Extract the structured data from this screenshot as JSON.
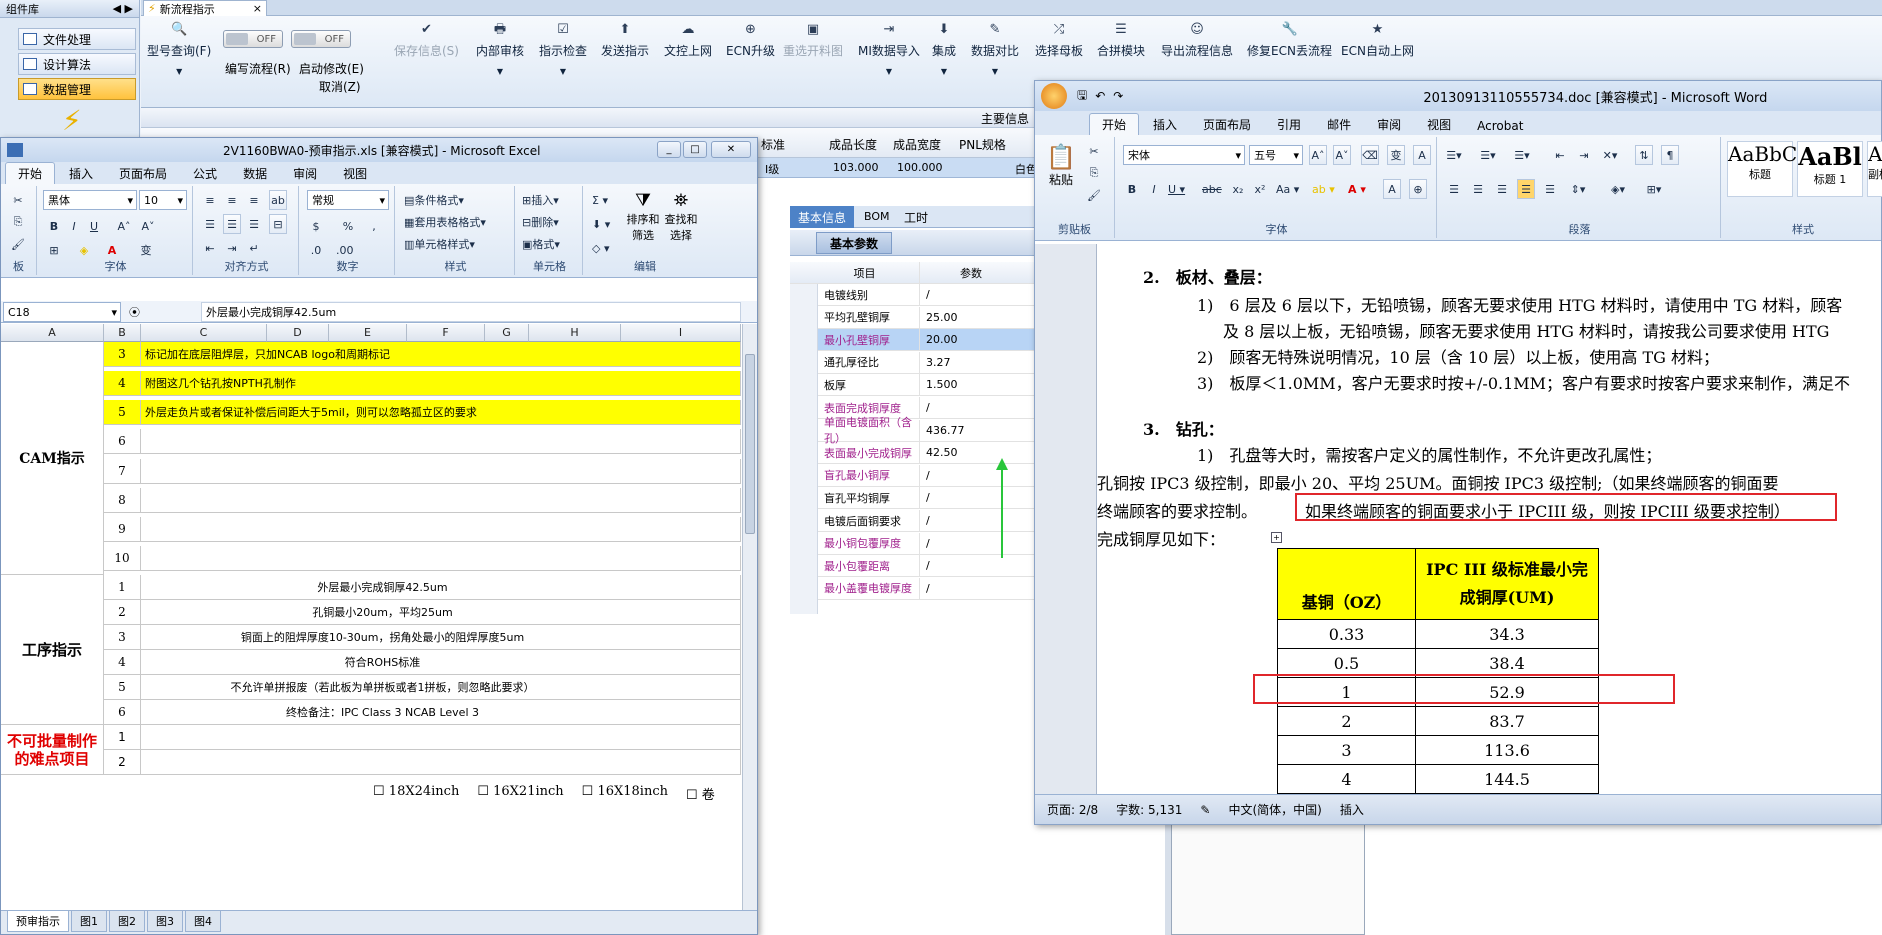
{
  "sidebar": {
    "header": "组件库",
    "items": [
      "文件处理",
      "设计算法",
      "数据管理"
    ]
  },
  "app": {
    "tab": "新流程指示",
    "toolbar": {
      "type_query": "型号查询(F)",
      "write_flow": "编写流程(R)",
      "start_modify": "启动修改(E)",
      "cancel": "取消(Z)",
      "save": "保存信息(S)",
      "audit": "内部审核",
      "check": "指示检查",
      "send": "发送指示",
      "upload": "文控上网",
      "ecn_up": "ECN升级",
      "reselect": "重选开料图",
      "mi_import": "MI数据导入",
      "integrate": "集成",
      "compare": "数据对比",
      "select_parent": "选择母板",
      "merge": "合拼模块",
      "export": "导出流程信息",
      "fix_ecn": "修复ECN丢流程",
      "ecn_auto": "ECN自动上网",
      "off1": "OFF",
      "off2": "OFF"
    },
    "grid_header": {
      "main_info": "主要信息",
      "std": "标准",
      "len": "成品长度",
      "wid": "成品宽度",
      "pnl": "PNL规格",
      "level": "I级",
      "len_v": "103.000",
      "wid_v": "100.000",
      "white": "白色"
    }
  },
  "excel": {
    "title": "2V1160BWA0-预审指示.xls [兼容模式] - Microsoft Excel",
    "tabs": [
      "开始",
      "插入",
      "页面布局",
      "公式",
      "数据",
      "审阅",
      "视图"
    ],
    "font": "黑体",
    "size": "10",
    "numfmt": "常规",
    "groups": {
      "clip": "板",
      "font": "字体",
      "align": "对齐方式",
      "num": "数字",
      "style": "样式",
      "cells": "单元格",
      "edit": "编辑"
    },
    "style_btns": [
      "条件格式",
      "套用表格格式",
      "单元格样式"
    ],
    "cell_btns": [
      "插入",
      "删除",
      "格式"
    ],
    "edit_btns": [
      "排序和筛选",
      "查找和选择"
    ],
    "namebox": "C18",
    "formula": "外层最小完成铜厚42.5um",
    "cols": [
      "A",
      "B",
      "C",
      "D",
      "E",
      "F",
      "G",
      "H",
      "I"
    ],
    "sections": {
      "cam": "CAM指示",
      "proc": "工序指示",
      "hard": "不可批量制作的难点项目"
    },
    "cam_rows": [
      [
        "3",
        "标记加在底层阻焊层，只加NCAB logo和周期标记"
      ],
      [
        "4",
        "附图这几个钻孔按NPTH孔制作"
      ],
      [
        "5",
        "外层走负片或者保证补偿后间距大于5mil，则可以忽略孤立区的要求"
      ],
      [
        "6",
        ""
      ],
      [
        "7",
        ""
      ],
      [
        "8",
        ""
      ],
      [
        "9",
        ""
      ],
      [
        "10",
        ""
      ]
    ],
    "proc_rows": [
      [
        "1",
        "外层最小完成铜厚42.5um"
      ],
      [
        "2",
        "孔铜最小20um，平均25um"
      ],
      [
        "3",
        "铜面上的阻焊厚度10-30um，拐角处最小的阻焊厚度5um"
      ],
      [
        "4",
        "符合ROHS标准"
      ],
      [
        "5",
        "不允许单拼报废（若此板为单拼板或者1拼板，则忽略此要求）"
      ],
      [
        "6",
        "终检备注：IPC Class 3 NCAB Level 3"
      ]
    ],
    "hard_rows": [
      "1",
      "2"
    ],
    "checks": [
      "18X24inch",
      "16X21inch",
      "16X18inch",
      "卷"
    ],
    "sheet_tabs": [
      "预审指示",
      "图1",
      "图2",
      "图3",
      "图4"
    ]
  },
  "props": {
    "tabs": [
      "基本信息",
      "BOM",
      "工时"
    ],
    "subtab": "基本参数",
    "col_item": "项目",
    "col_param": "参数",
    "rows": [
      [
        "电镀线别",
        "/",
        "n"
      ],
      [
        "平均孔壁铜厚",
        "25.00",
        "n"
      ],
      [
        "最小孔壁铜厚",
        "20.00",
        "p"
      ],
      [
        "通孔厚径比",
        "3.27",
        "n"
      ],
      [
        "板厚",
        "1.500",
        "n"
      ],
      [
        "表面完成铜厚度",
        "/",
        "p"
      ],
      [
        "单面电镀面积（含孔）",
        "436.77",
        "p"
      ],
      [
        "表面最小完成铜厚",
        "42.50",
        "p"
      ],
      [
        "盲孔最小铜厚",
        "/",
        "p"
      ],
      [
        "盲孔平均铜厚",
        "/",
        "n"
      ],
      [
        "电镀后面铜要求",
        "/",
        "n"
      ],
      [
        "最小铜包覆厚度",
        "/",
        "p"
      ],
      [
        "最小包覆距离",
        "/",
        "p"
      ],
      [
        "最小盖覆电镀厚度",
        "/",
        "p"
      ]
    ]
  },
  "word": {
    "title": "20130913110555734.doc [兼容模式] - Microsoft Word",
    "tabs": [
      "开始",
      "插入",
      "页面布局",
      "引用",
      "邮件",
      "审阅",
      "视图",
      "Acrobat"
    ],
    "font": "宋体",
    "size": "五号",
    "groups": {
      "clip": "剪贴板",
      "font": "字体",
      "para": "段落",
      "style": "样式"
    },
    "paste": "粘贴",
    "styles": [
      [
        "AaBbC",
        "标题"
      ],
      [
        "AaBl",
        "标题 1"
      ],
      [
        "AaB",
        "副标"
      ]
    ],
    "lines": [
      "2.　板材、叠层：",
      "1)　6 层及 6 层以下，无铅喷锡，顾客无要求使用 HTG 材料时，请使用中 TG 材料，顾客",
      "及 8 层以上板，无铅喷锡，顾客无要求使用 HTG 材料时，请按我公司要求使用 HTG",
      "2)　顾客无特殊说明情况，10 层（含 10 层）以上板，使用高 TG 材料；",
      "3)　板厚＜1.0MM，客户无要求时按+/-0.1MM；客户有要求时按客户要求来制作，满足不",
      "3.　钻孔：",
      "1)　孔盘等大时，需按客户定义的属性制作，不允许更改孔属性；",
      "孔铜按 IPC3 级控制，即最小 20、平均 25UM。面铜按 IPC3 级控制;（如果终端顾客的铜面要",
      "终端顾客的要求控制。",
      "如果终端顾客的铜面要求小于 IPCIII 级，则按 IPCIII 级要求控制）",
      "完成铜厚见如下："
    ],
    "table_head": [
      "基铜（OZ）",
      "IPC III 级标准最小完成铜厚(UM)"
    ],
    "table_rows": [
      [
        "0.33",
        "34.3"
      ],
      [
        "0.5",
        "38.4"
      ],
      [
        "1",
        "52.9"
      ],
      [
        "2",
        "83.7"
      ],
      [
        "3",
        "113.6"
      ],
      [
        "4",
        "144.5"
      ]
    ],
    "status": {
      "page": "页面: 2/8",
      "words": "字数: 5,131",
      "lang": "中文(简体，中国)",
      "mode": "插入"
    }
  }
}
